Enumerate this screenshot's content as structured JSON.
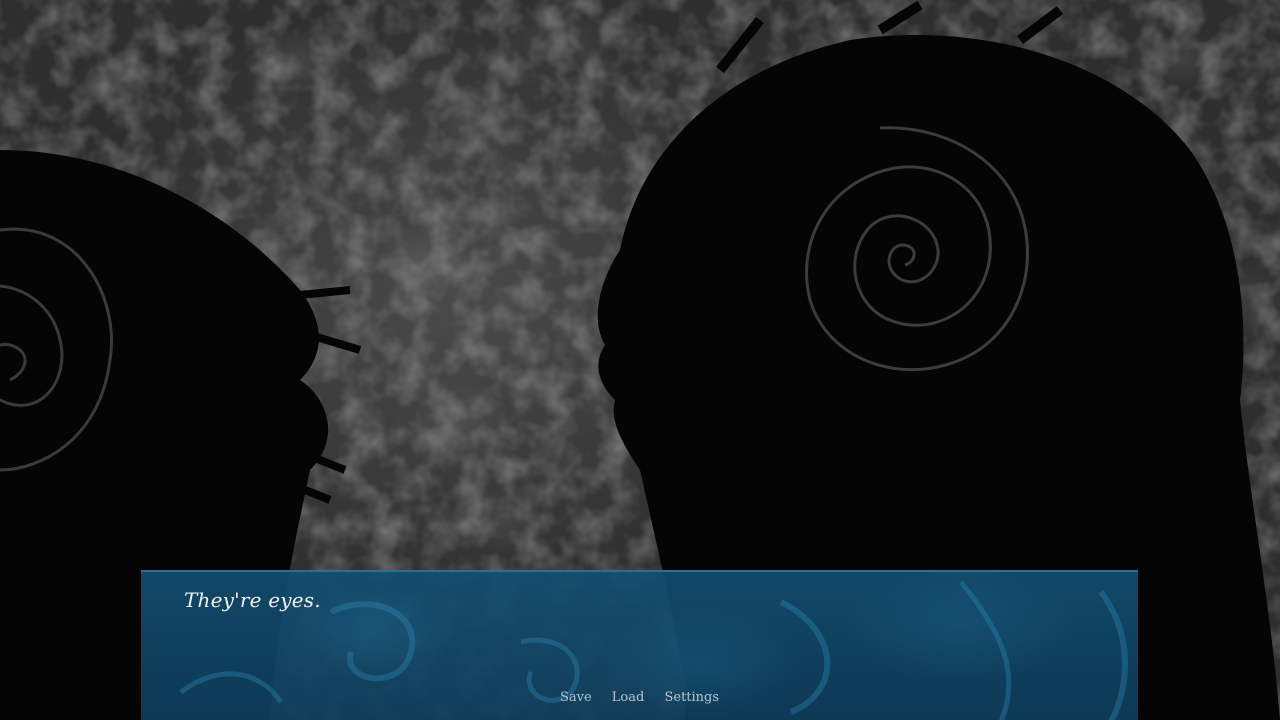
{
  "dialogue": {
    "text": "They're eyes."
  },
  "quick_menu": {
    "items": [
      {
        "label": "Save"
      },
      {
        "label": "Load"
      },
      {
        "label": "Settings"
      }
    ]
  },
  "colors": {
    "dialog_bg": "#12506f",
    "dialog_text": "#f2f2f2",
    "menu_text": "#b9c6cd",
    "background_wall": "#3c3c3c"
  }
}
